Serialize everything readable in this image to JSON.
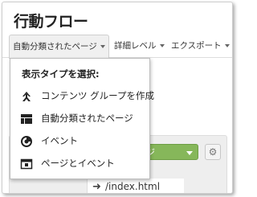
{
  "window": {
    "title": "行動フロー"
  },
  "toolbar": {
    "buttons": [
      {
        "label": "自動分類されたページ"
      },
      {
        "label": "詳細レベル"
      },
      {
        "label": "エクスポート"
      }
    ]
  },
  "dropdown": {
    "heading": "表示タイプを選択:",
    "items": [
      {
        "label": "コンテンツ グループを作成",
        "icon": "merge-arrow-icon"
      },
      {
        "label": "自動分類されたページ",
        "icon": "page-layout-icon"
      },
      {
        "label": "イベント",
        "icon": "event-icon"
      },
      {
        "label": "ページとイベント",
        "icon": "page-event-icon"
      }
    ]
  },
  "background": {
    "green_button_partial": "ジ",
    "file_path": "/index.html"
  }
}
